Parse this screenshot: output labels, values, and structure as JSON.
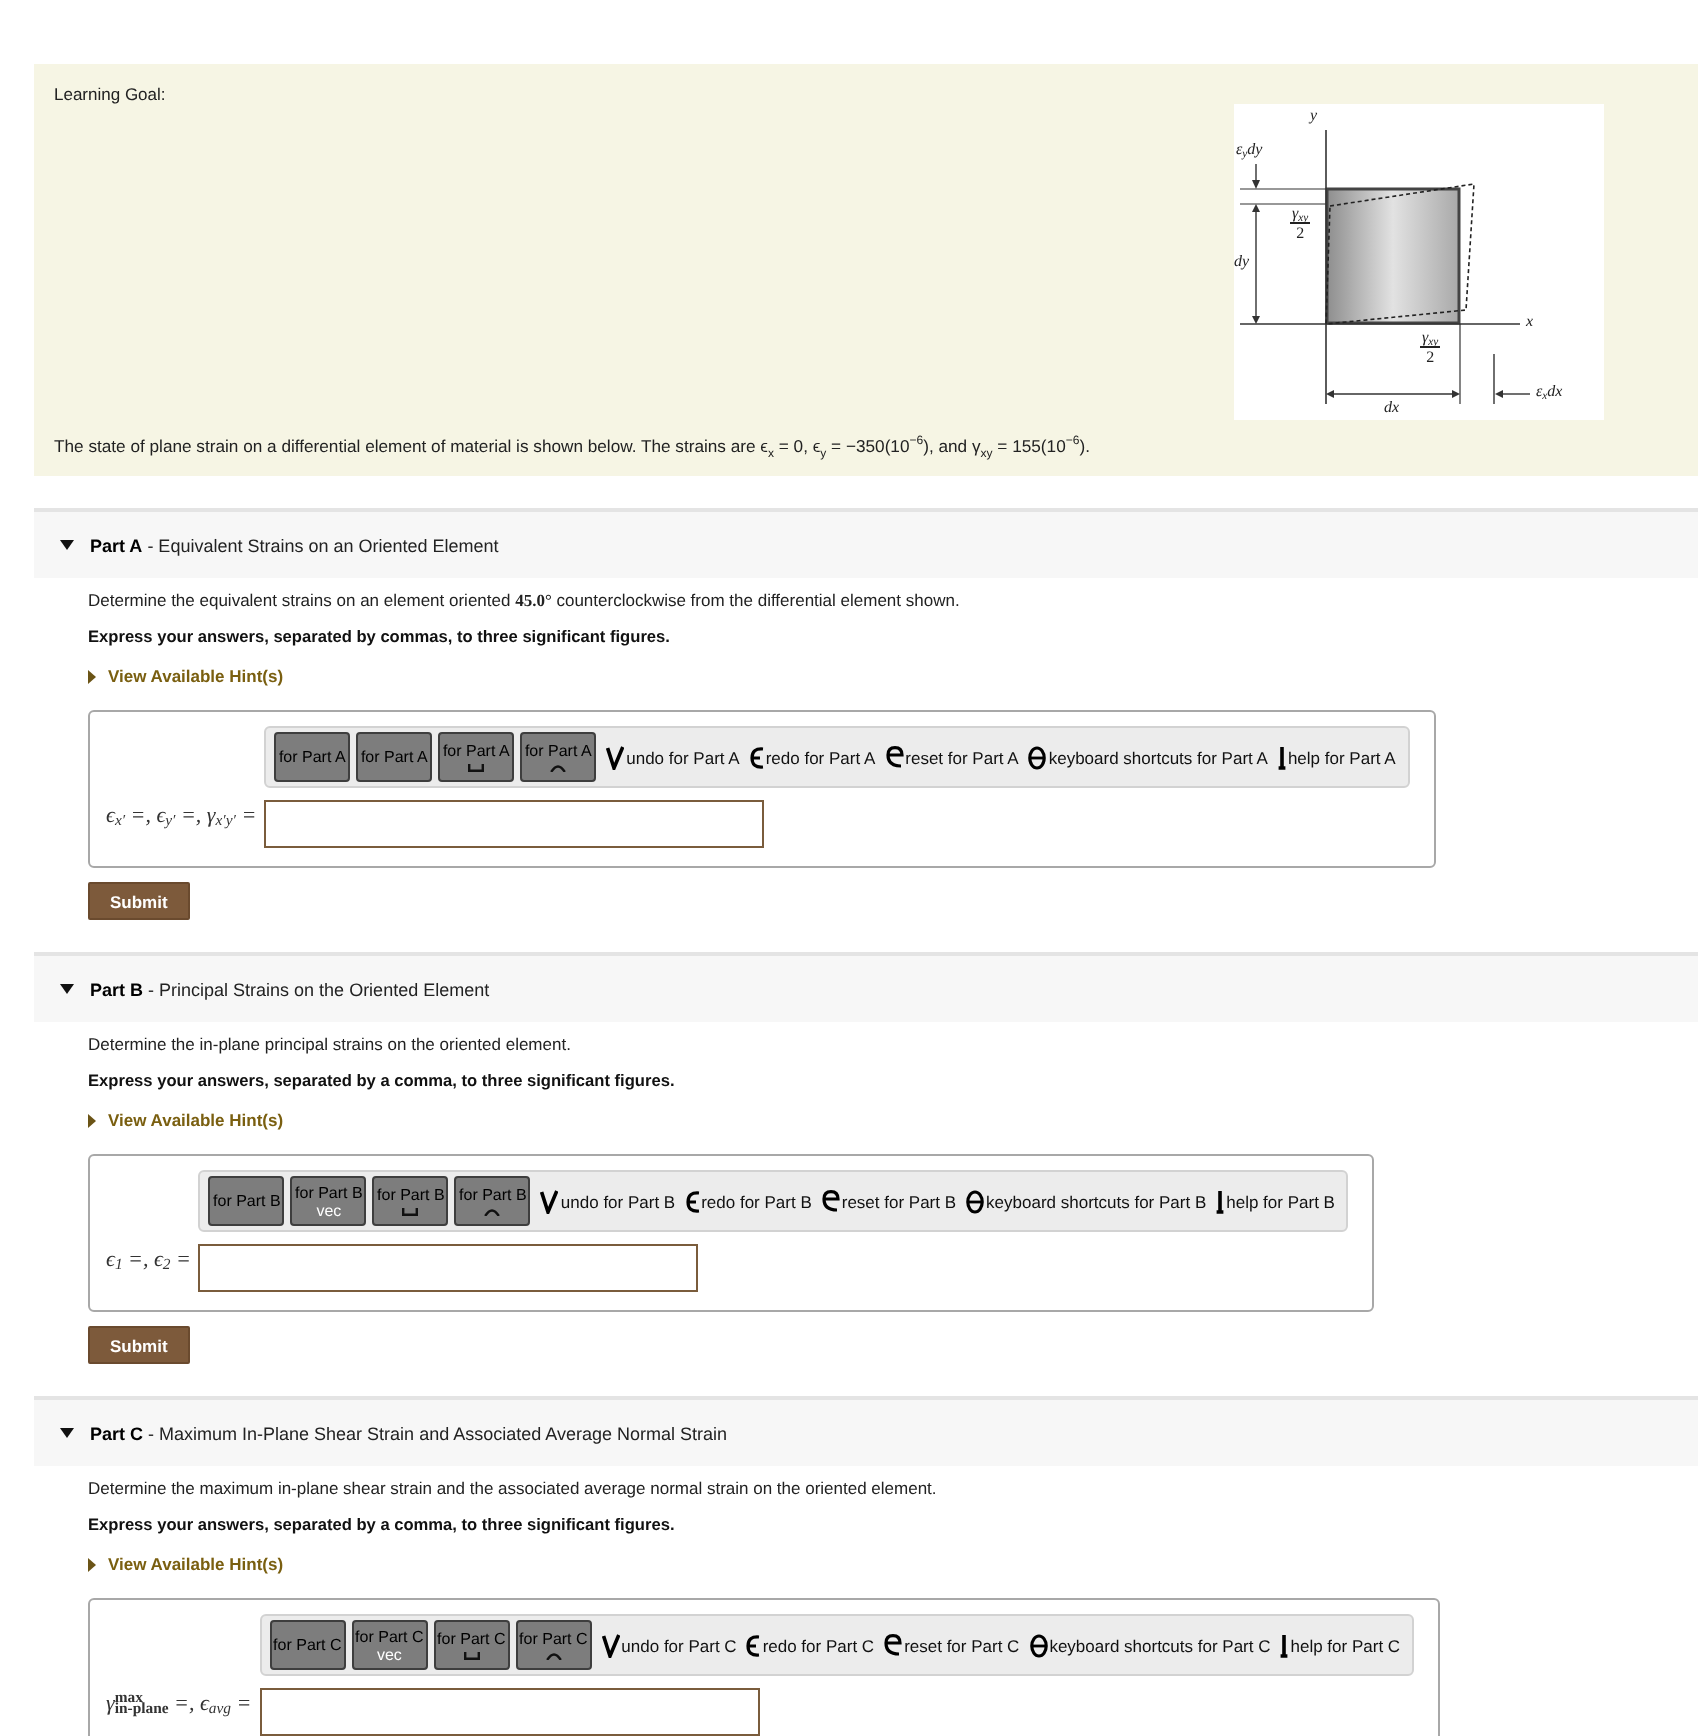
{
  "learning_goal": {
    "title": "Learning Goal:",
    "figure": {
      "y_axis": "y",
      "x_axis": "x",
      "top_strain": "ε$_{y}$dy",
      "height": "dy",
      "shear_left": {
        "numerator": "γ$_{xy}$",
        "denominator": "2"
      },
      "shear_bottom": {
        "numerator": "γ$_{xy}$",
        "denominator": "2"
      },
      "width": "dx",
      "right_strain": "ε$_{x}$dx"
    },
    "text": "The state of plane strain on a differential element of material is shown below. The strains are ϵ$_{x}$ = 0, ϵ$_{y}$ = −350(10$^{−6}$), and γ$_{xy}$ = 155(10$^{−6}$)."
  },
  "parts": [
    {
      "title": "**Part A** - Equivalent Strains on an Oriented Element",
      "expanded": true,
      "question": "Determine the equivalent strains on an element oriented **45.0°** counterclockwise from the differential element shown.",
      "instruction": "Express your answers, separated by commas, to three significant figures.",
      "hint": {
        "label": "View Available Hint(s)",
        "expanded": false
      },
      "toolbar": {
        "buttons": [
          {
            "label": "for Part A"
          },
          {
            "label": "for Part A"
          },
          {
            "label": "for Part A"
          },
          {
            "label": "for Part A"
          }
        ],
        "tools": [
          {
            "kind": "undo",
            "label": "undo for Part A"
          },
          {
            "kind": "redo",
            "label": "redo for Part A"
          },
          {
            "kind": "reset",
            "label": "reset for Part A"
          },
          {
            "kind": "keyboard",
            "label": "keyboard shortcuts for Part A"
          },
          {
            "kind": "help",
            "label": "help for Part A"
          }
        ]
      },
      "answer_label": "ϵ$_{x′}$ =, ϵ$_{y′}$ =, γ$_{x′y′}$ =",
      "submit": "Submit"
    },
    {
      "title": "**Part B** - Principal Strains on the Oriented Element",
      "expanded": true,
      "question": "Determine the in-plane principal strains on the oriented element.",
      "instruction": "Express your answers, separated by a comma, to three significant figures.",
      "hint": {
        "label": "View Available Hint(s)",
        "expanded": false
      },
      "toolbar": {
        "buttons": [
          {
            "label": "for Part B"
          },
          {
            "label": "for Part B",
            "sub": "vec"
          },
          {
            "label": "for Part B"
          },
          {
            "label": "for Part B"
          }
        ],
        "tools": [
          {
            "kind": "undo",
            "label": "undo for Part B"
          },
          {
            "kind": "redo",
            "label": "redo for Part B"
          },
          {
            "kind": "reset",
            "label": "reset for Part B"
          },
          {
            "kind": "keyboard",
            "label": "keyboard shortcuts for Part B"
          },
          {
            "kind": "help",
            "label": "help for Part B"
          }
        ]
      },
      "answer_label": "ϵ$_{1}$ =, ϵ$_{2}$ =",
      "submit": "Submit"
    },
    {
      "title": "**Part C** - Maximum In-Plane Shear Strain and Associated Average Normal Strain",
      "expanded": true,
      "question": "Determine the maximum in-plane shear strain and the associated average normal strain on the oriented element.",
      "instruction": "Express your answers, separated by a comma, to three significant figures.",
      "hint": {
        "label": "View Available Hint(s)",
        "expanded": false
      },
      "toolbar": {
        "buttons": [
          {
            "label": "for Part C"
          },
          {
            "label": "for Part C",
            "sub": "vec"
          },
          {
            "label": "for Part C"
          },
          {
            "label": "for Part C"
          }
        ],
        "tools": [
          {
            "kind": "undo",
            "label": "undo for Part C"
          },
          {
            "kind": "redo",
            "label": "redo for Part C"
          },
          {
            "kind": "reset",
            "label": "reset for Part C"
          },
          {
            "kind": "keyboard",
            "label": "keyboard shortcuts for Part C"
          },
          {
            "kind": "help",
            "label": "help for Part C"
          }
        ]
      },
      "answer_label": "γ$^{max}$$_{in-plane}$ =, ϵ$_{avg}$ ="
    }
  ]
}
